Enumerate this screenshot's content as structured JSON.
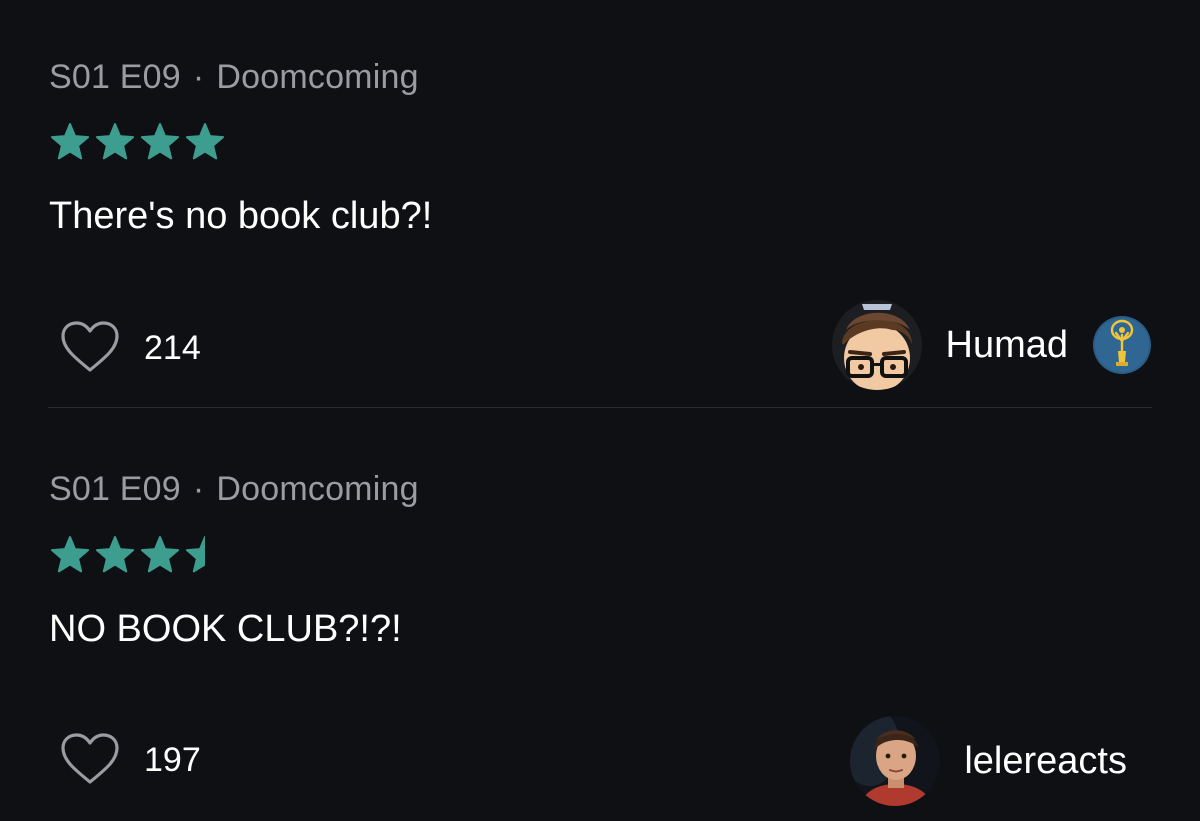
{
  "colors": {
    "background": "#0f1014",
    "star": "#3d9d8e",
    "muted_text": "#9a9ca2",
    "divider": "#2a2c31"
  },
  "reviews": [
    {
      "season_episode": "S01 E09",
      "separator": "·",
      "episode_title": "Doomcoming",
      "rating": 4,
      "rating_max": 5,
      "text": "There's no book club?!",
      "like_icon": "heart-outline-icon",
      "likes": "214",
      "username": "Humad",
      "badge_icon": "emmy-statuette-icon"
    },
    {
      "season_episode": "S01 E09",
      "separator": "·",
      "episode_title": "Doomcoming",
      "rating": 3.5,
      "rating_max": 5,
      "text": "NO BOOK CLUB?!?!",
      "like_icon": "heart-outline-icon",
      "likes": "197",
      "username": "lelereacts"
    }
  ]
}
